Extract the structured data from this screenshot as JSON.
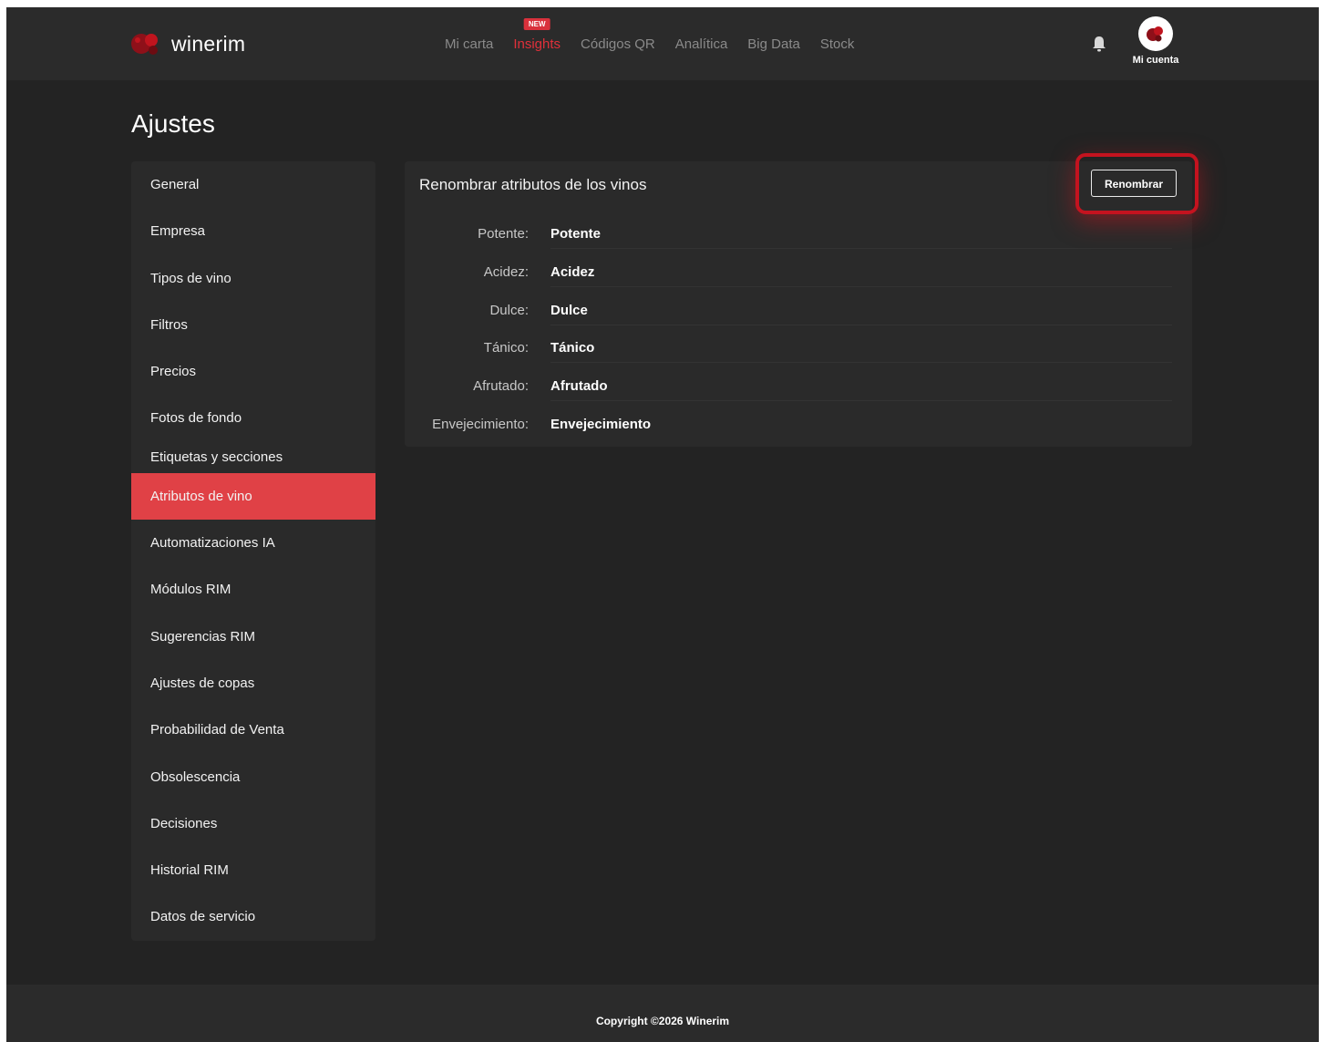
{
  "brand": {
    "name": "winerim"
  },
  "nav": {
    "items": [
      {
        "label": "Mi carta"
      },
      {
        "label": "Insights",
        "badge": "NEW"
      },
      {
        "label": "Códigos QR"
      },
      {
        "label": "Analítica"
      },
      {
        "label": "Big Data"
      },
      {
        "label": "Stock"
      }
    ]
  },
  "account": {
    "label": "Mi cuenta"
  },
  "page": {
    "title": "Ajustes"
  },
  "sidebar": {
    "items": [
      {
        "label": "General"
      },
      {
        "label": "Empresa"
      },
      {
        "label": "Tipos de vino"
      },
      {
        "label": "Filtros"
      },
      {
        "label": "Precios"
      },
      {
        "label": "Fotos de fondo"
      },
      {
        "label": "Etiquetas y secciones"
      },
      {
        "label": "Atributos de vino"
      },
      {
        "label": "Automatizaciones IA"
      },
      {
        "label": "Módulos RIM"
      },
      {
        "label": "Sugerencias RIM"
      },
      {
        "label": "Ajustes de copas"
      },
      {
        "label": "Probabilidad de Venta"
      },
      {
        "label": "Obsolescencia"
      },
      {
        "label": "Decisiones"
      },
      {
        "label": "Historial RIM"
      },
      {
        "label": "Datos de servicio"
      }
    ],
    "active_index": 7
  },
  "card": {
    "title": "Renombrar atributos de los vinos",
    "button_label": "Renombrar",
    "attributes": [
      {
        "label": "Potente:",
        "value": "Potente"
      },
      {
        "label": "Acidez:",
        "value": "Acidez"
      },
      {
        "label": "Dulce:",
        "value": "Dulce"
      },
      {
        "label": "Tánico:",
        "value": "Tánico"
      },
      {
        "label": "Afrutado:",
        "value": "Afrutado"
      },
      {
        "label": "Envejecimiento:",
        "value": "Envejecimiento"
      }
    ]
  },
  "footer": {
    "copyright": "Copyright ©2026 Winerim"
  },
  "colors": {
    "accent": "#e04146",
    "highlight": "#c4131f",
    "background": "#232323",
    "panel": "#2a2a2a"
  }
}
